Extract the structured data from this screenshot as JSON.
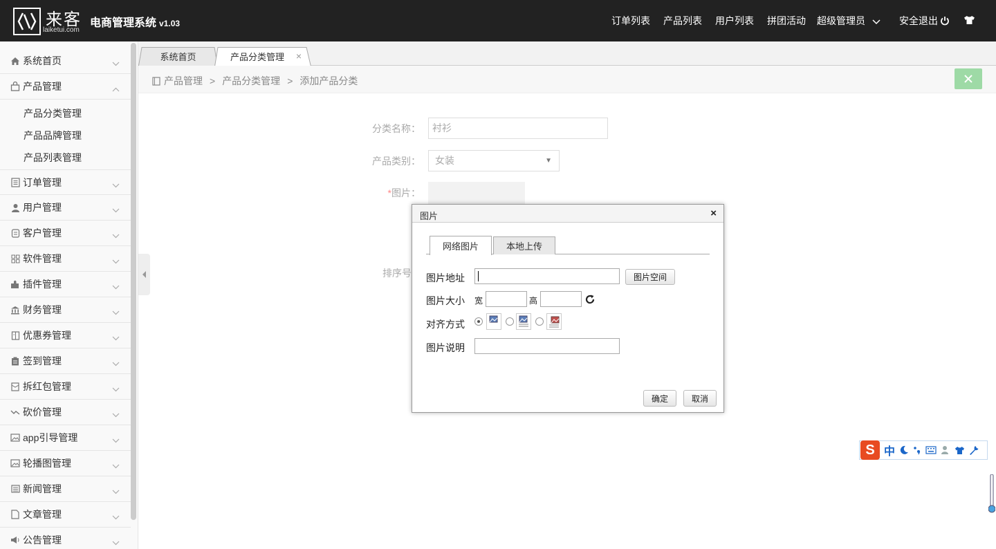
{
  "header": {
    "logo_cn": "来客",
    "logo_en": "laiketui.com",
    "title": "电商管理系统",
    "version": "v1.03",
    "nav": [
      "订单列表",
      "产品列表",
      "用户列表",
      "拼团活动",
      "超级管理员",
      "安全退出"
    ]
  },
  "sidebar": {
    "items": [
      {
        "label": "系统首页",
        "icon": "home-icon"
      },
      {
        "label": "产品管理",
        "icon": "bag-icon",
        "expanded": true,
        "children": [
          "产品分类管理",
          "产品品牌管理",
          "产品列表管理"
        ]
      },
      {
        "label": "订单管理",
        "icon": "list-icon"
      },
      {
        "label": "用户管理",
        "icon": "user-icon"
      },
      {
        "label": "客户管理",
        "icon": "contact-icon"
      },
      {
        "label": "软件管理",
        "icon": "grid-icon"
      },
      {
        "label": "插件管理",
        "icon": "puzzle-icon"
      },
      {
        "label": "财务管理",
        "icon": "bank-icon"
      },
      {
        "label": "优惠券管理",
        "icon": "coupon-icon"
      },
      {
        "label": "签到管理",
        "icon": "clipboard-icon"
      },
      {
        "label": "拆红包管理",
        "icon": "redpacket-icon"
      },
      {
        "label": "砍价管理",
        "icon": "trend-icon"
      },
      {
        "label": "app引导管理",
        "icon": "image-icon"
      },
      {
        "label": "轮播图管理",
        "icon": "image-icon"
      },
      {
        "label": "新闻管理",
        "icon": "news-icon"
      },
      {
        "label": "文章管理",
        "icon": "file-icon"
      },
      {
        "label": "公告管理",
        "icon": "megaphone-icon"
      }
    ]
  },
  "tabs": [
    {
      "label": "系统首页",
      "active": false
    },
    {
      "label": "产品分类管理",
      "active": true,
      "close": "×"
    }
  ],
  "breadcrumb": {
    "items": [
      "产品管理",
      "产品分类管理",
      "添加产品分类"
    ],
    "separator": ">"
  },
  "form": {
    "name_label": "分类名称：",
    "name_value": "衬衫",
    "category_label": "产品类别：",
    "category_value": "女装",
    "image_label": "图片：",
    "image_required": "*",
    "sort_label": "排序号"
  },
  "dialog": {
    "title": "图片",
    "close": "×",
    "tabs": [
      "网络图片",
      "本地上传"
    ],
    "url_label": "图片地址",
    "url_value": "",
    "space_button": "图片空间",
    "size_label": "图片大小",
    "width_label": "宽",
    "height_label": "高",
    "align_label": "对齐方式",
    "desc_label": "图片说明",
    "ok_button": "确定",
    "cancel_button": "取消"
  },
  "ime": {
    "logo": "S",
    "mode": "中"
  },
  "colors": {
    "topbar": "#222222",
    "close_button": "#9edaa6",
    "ime_logo": "#e84b21",
    "ime_blue": "#1a66c9"
  }
}
